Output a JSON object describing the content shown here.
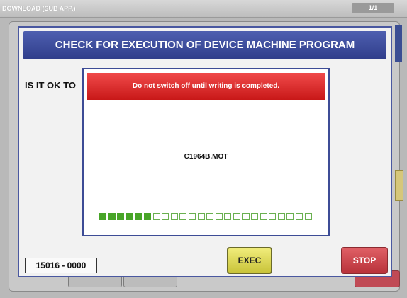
{
  "window": {
    "title": "DOWNLOAD (SUB APP.)",
    "page_indicator": "1/1"
  },
  "main": {
    "header": "CHECK FOR EXECUTION OF DEVICE MACHINE PROGRAM",
    "question": "IS IT OK TO",
    "code": "15016 - 0000",
    "exec_label": "EXEC",
    "stop_label": "STOP"
  },
  "dialog": {
    "warning": "Do not switch off until writing is completed.",
    "filename": "C1964B.MOT",
    "progress": {
      "filled": 6,
      "total": 24
    },
    "colors": {
      "filled": "#48a528",
      "empty": "#ffffff",
      "header": "#d92525"
    }
  }
}
